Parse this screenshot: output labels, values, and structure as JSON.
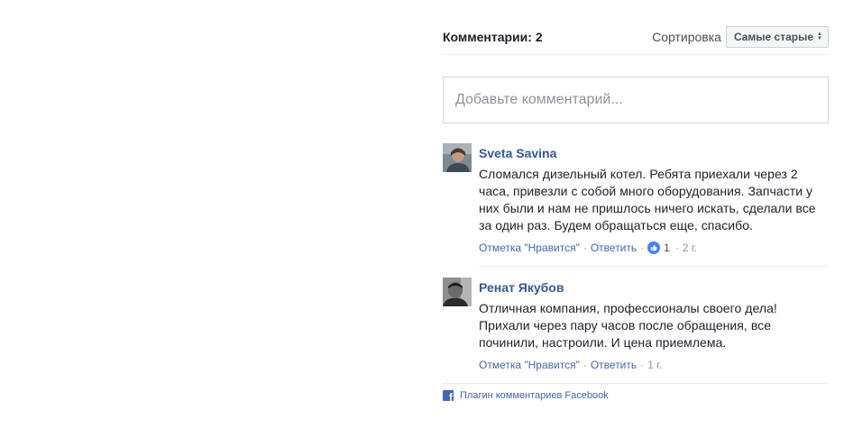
{
  "header": {
    "count_label": "Комментарии: 2",
    "sort_label": "Сортировка",
    "sort_value": "Самые старые"
  },
  "input": {
    "placeholder": "Добавьте комментарий..."
  },
  "comments": [
    {
      "author": "Sveta Savina",
      "text": "Сломался дизельный котел. Ребята приехали через 2 часа, привезли с собой много оборудования. Запчасти у них были и нам не пришлось ничего искать, сделали все за один раз. Будем обращаться еще, спасибо.",
      "like_label": "Отметка \"Нравится\"",
      "reply_label": "Ответить",
      "like_count": "1",
      "time": "2 г."
    },
    {
      "author": "Ренат Якубов",
      "text": "Отличная компания, профессионалы своего дела! Прихали через пару часов после обращения, все починили, настроили. И цена приемлема.",
      "like_label": "Отметка \"Нравится\"",
      "reply_label": "Ответить",
      "time": "1 г."
    }
  ],
  "footer": {
    "label": "Плагин комментариев Facebook"
  },
  "colors": {
    "link": "#4267b2",
    "author": "#365899",
    "like_badge": "#4080ff"
  },
  "icons": [
    "like-icon",
    "facebook-icon",
    "sort-arrows-icon"
  ]
}
